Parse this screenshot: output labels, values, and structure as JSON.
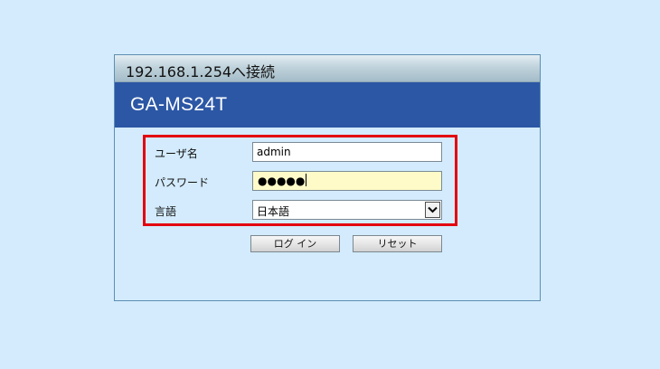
{
  "window": {
    "title": "192.168.1.254へ接続"
  },
  "banner": {
    "product_name": "GA-MS24T"
  },
  "form": {
    "username": {
      "label": "ユーザ名",
      "value": "admin"
    },
    "password": {
      "label": "パスワード",
      "masked_value": "●●●●●"
    },
    "language": {
      "label": "言語",
      "selected": "日本語"
    }
  },
  "buttons": {
    "login": "ログ イン",
    "reset": "リセット"
  },
  "colors": {
    "page_background": "#d3ebfc",
    "banner": "#2c57a5",
    "highlight_border": "#e3000f",
    "password_field": "#fffbc8"
  },
  "icons": {
    "dropdown": "chevron-down-icon"
  }
}
